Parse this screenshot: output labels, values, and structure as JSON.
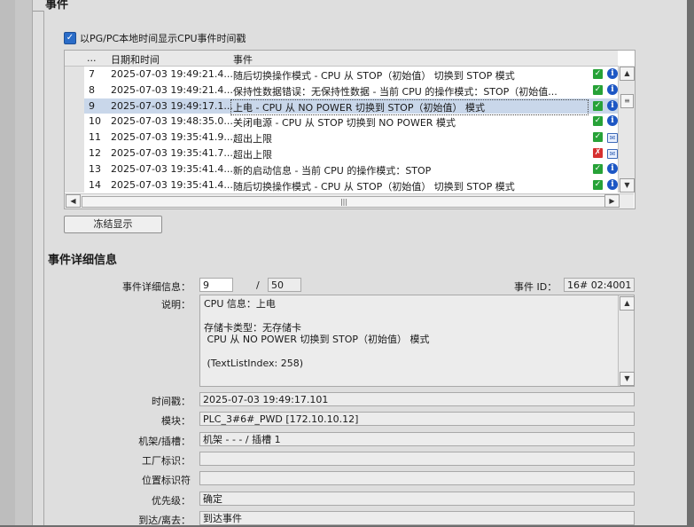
{
  "events_section": {
    "title": "事件",
    "checkbox_label": "以PG/PC本地时间显示CPU事件时间戳",
    "checkbox_checked": true,
    "columns": {
      "dots": "...",
      "datetime": "日期和时间",
      "event": "事件"
    },
    "rows": [
      {
        "no": "7",
        "datetime": "2025-07-03 19:49:21.4...",
        "event": "随后切换操作模式 - CPU 从 STOP（初始值） 切换到 STOP 模式",
        "status_icon": "check-icon",
        "info_icon": "info-icon"
      },
      {
        "no": "8",
        "datetime": "2025-07-03 19:49:21.4...",
        "event": "保持性数据错误：无保持性数据 - 当前 CPU 的操作模式：STOP（初始值...",
        "status_icon": "check-icon",
        "info_icon": "info-icon"
      },
      {
        "no": "9",
        "datetime": "2025-07-03 19:49:17.1...",
        "event": "上电 - CPU 从 NO POWER 切换到 STOP（初始值） 模式",
        "status_icon": "check-icon",
        "info_icon": "info-icon",
        "selected": true
      },
      {
        "no": "10",
        "datetime": "2025-07-03 19:48:35.0...",
        "event": "关闭电源 - CPU 从 STOP 切换到 NO POWER 模式",
        "status_icon": "check-icon",
        "info_icon": "info-icon"
      },
      {
        "no": "11",
        "datetime": "2025-07-03 19:35:41.9...",
        "event": "超出上限",
        "status_icon": "check-icon",
        "info_icon": "message-icon"
      },
      {
        "no": "12",
        "datetime": "2025-07-03 19:35:41.7...",
        "event": "超出上限",
        "status_icon": "error-icon",
        "info_icon": "message-icon"
      },
      {
        "no": "13",
        "datetime": "2025-07-03 19:35:41.4...",
        "event": "新的启动信息 - 当前 CPU 的操作模式：STOP",
        "status_icon": "check-icon",
        "info_icon": "info-icon"
      },
      {
        "no": "14",
        "datetime": "2025-07-03 19:35:41.4...",
        "event": "随后切换操作模式 - CPU 从 STOP（初始值） 切换到 STOP 模式",
        "status_icon": "check-icon",
        "info_icon": "info-icon"
      }
    ],
    "freeze_button": "冻结显示"
  },
  "detail_section": {
    "title": "事件详细信息",
    "detail_label": "事件详细信息：",
    "detail_current": "9",
    "detail_separator": "/",
    "detail_total": "50",
    "event_id_label": "事件 ID：",
    "event_id_value": "16# 02:4001",
    "description_label": "说明：",
    "description_lines": [
      "CPU 信息：上电",
      "",
      "存储卡类型：无存储卡",
      " CPU 从 NO POWER 切换到 STOP（初始值） 模式",
      "",
      " (TextListIndex: 258)"
    ],
    "timestamp_label": "时间戳：",
    "timestamp_value": "2025-07-03 19:49:17.101",
    "module_label": "模块：",
    "module_value": "PLC_3#6#_PWD [172.10.10.12]",
    "rack_label": "机架/插槽：",
    "rack_value": "机架 - - - / 插槽 1",
    "plant_label": "工厂标识：",
    "plant_value": "",
    "location_label": "位置标识符",
    "location_value": "",
    "priority_label": "优先级：",
    "priority_value": "确定",
    "arrive_label": "到达/离去：",
    "arrive_value": "到达事件"
  },
  "colors": {
    "selected_row": "#c9d7ea",
    "ok_green": "#27a238",
    "info_blue": "#1d57c4",
    "error_red": "#d63030"
  }
}
